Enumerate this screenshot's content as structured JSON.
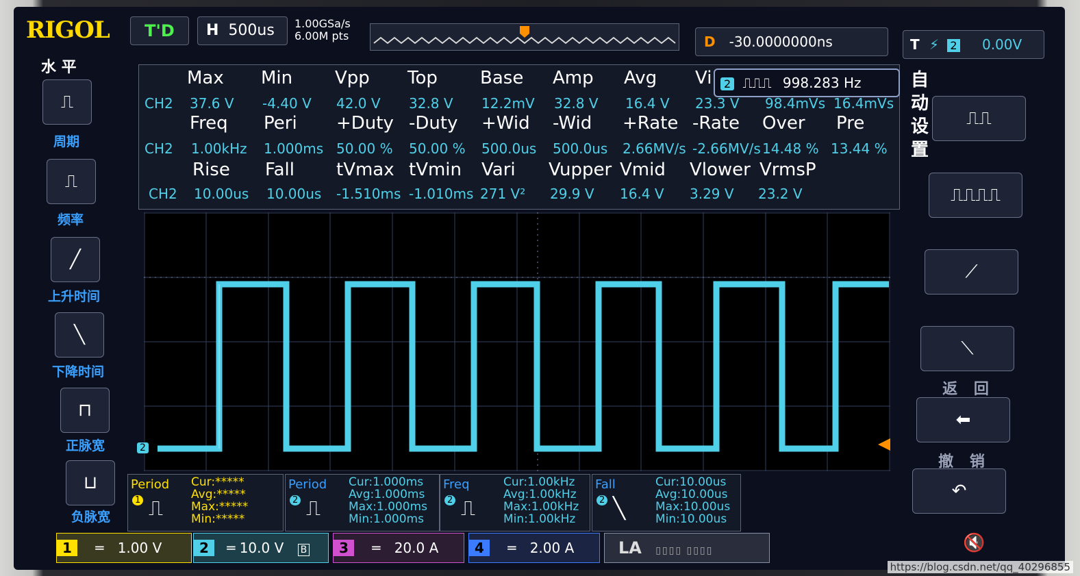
{
  "brand": "RIGOL",
  "status": {
    "run_state": "T'D",
    "timebase_label": "H",
    "timebase_value": "500us",
    "sample_rate": "1.00GSa/s",
    "memory_depth": "6.00M pts"
  },
  "delay": {
    "label": "D",
    "value": "-30.0000000ns"
  },
  "trigger": {
    "label": "T",
    "level": "0.00V",
    "source": "2"
  },
  "left_menu": {
    "title": "水 平",
    "items": [
      {
        "label": "周期",
        "icon": "period-icon"
      },
      {
        "label": "频率",
        "icon": "frequency-icon"
      },
      {
        "label": "上升时间",
        "icon": "rise-time-icon"
      },
      {
        "label": "下降时间",
        "icon": "fall-time-icon"
      },
      {
        "label": "正脉宽",
        "icon": "positive-width-icon"
      },
      {
        "label": "负脉宽",
        "icon": "negative-width-icon"
      }
    ]
  },
  "freq_counter": {
    "channel": "2",
    "value": "998.283 Hz"
  },
  "measurements": {
    "channel": "CH2",
    "rows": [
      {
        "headers": [
          "Max",
          "Min",
          "Vpp",
          "Top",
          "Base",
          "Amp",
          "Avg",
          "Vi"
        ],
        "values": [
          "37.6 V",
          "-4.40 V",
          "42.0 V",
          "32.8 V",
          "12.2mV",
          "32.8 V",
          "16.4 V",
          "23.3 V",
          "98.4mVs",
          "16.4mVs"
        ]
      },
      {
        "headers": [
          "Freq",
          "Peri",
          "+Duty",
          "-Duty",
          "+Wid",
          "-Wid",
          "+Rate",
          "-Rate",
          "Over",
          "Pre"
        ],
        "values": [
          "1.00kHz",
          "1.000ms",
          "50.00 %",
          "50.00 %",
          "500.0us",
          "500.0us",
          "2.66MV/s",
          "-2.66MV/s",
          "14.48 %",
          "13.44 %"
        ]
      },
      {
        "headers": [
          "Rise",
          "Fall",
          "tVmax",
          "tVmin",
          "Vari",
          "Vupper",
          "Vmid",
          "Vlower",
          "VrmsP"
        ],
        "values": [
          "10.00us",
          "10.00us",
          "-1.510ms",
          "-1.010ms",
          "271 V²",
          "29.9 V",
          "16.4 V",
          "3.29 V",
          "23.2 V"
        ]
      }
    ]
  },
  "right_menu": {
    "title": "自动设置",
    "back_label": "返 回",
    "undo_label": "撤 销"
  },
  "stat_cards": [
    {
      "title": "Period",
      "ch": "1",
      "cur": "Cur:*****",
      "avg": "Avg:*****",
      "max": "Max:*****",
      "min": "Min:*****",
      "color": "#ffe000"
    },
    {
      "title": "Period",
      "ch": "2",
      "cur": "Cur:1.000ms",
      "avg": "Avg:1.000ms",
      "max": "Max:1.000ms",
      "min": "Min:1.000ms",
      "color": "#4fd0e8"
    },
    {
      "title": "Freq",
      "ch": "2",
      "cur": "Cur:1.00kHz",
      "avg": "Avg:1.00kHz",
      "max": "Max:1.00kHz",
      "min": "Min:1.00kHz",
      "color": "#4fd0e8"
    },
    {
      "title": "Fall",
      "ch": "2",
      "cur": "Cur:10.00us",
      "avg": "Avg:10.00us",
      "max": "Max:10.00us",
      "min": "Min:10.00us",
      "color": "#4fd0e8"
    }
  ],
  "channels": [
    {
      "num": "1",
      "scale": "1.00 V",
      "color": "#ffe000"
    },
    {
      "num": "2",
      "scale": "10.0 V",
      "color": "#4fd0e8"
    },
    {
      "num": "3",
      "scale": "20.0 A",
      "color": "#d050d0"
    },
    {
      "num": "4",
      "scale": "2.00 A",
      "color": "#3a7bff"
    }
  ],
  "la_label": "LA",
  "watermark": "https://blog.csdn.net/qq_40296855"
}
